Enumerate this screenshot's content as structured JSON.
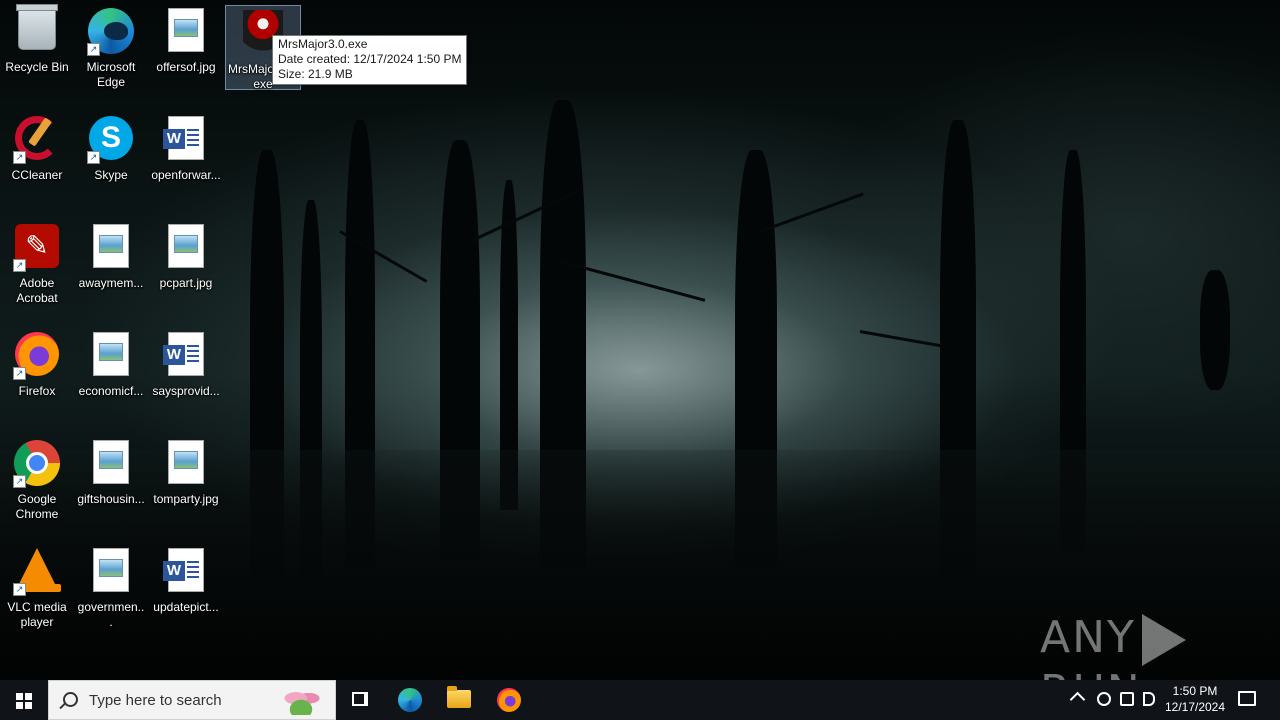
{
  "desktop": {
    "icons": [
      {
        "label": "Recycle Bin",
        "icon": "recycle-bin-icon"
      },
      {
        "label": "Microsoft Edge",
        "icon": "edge-icon"
      },
      {
        "label": "offersof.jpg",
        "icon": "image-file-icon"
      },
      {
        "label": "MrsMajor3.0.exe",
        "icon": "mrsmajor-exe-icon"
      },
      {
        "label": "CCleaner",
        "icon": "ccleaner-icon"
      },
      {
        "label": "Skype",
        "icon": "skype-icon"
      },
      {
        "label": "openforwar...",
        "icon": "word-doc-icon"
      },
      {
        "label": "Adobe Acrobat",
        "icon": "acrobat-icon"
      },
      {
        "label": "awaymem...",
        "icon": "image-file-icon"
      },
      {
        "label": "pcpart.jpg",
        "icon": "image-file-icon"
      },
      {
        "label": "Firefox",
        "icon": "firefox-icon"
      },
      {
        "label": "economicf...",
        "icon": "image-file-icon"
      },
      {
        "label": "saysprovid...",
        "icon": "word-doc-icon"
      },
      {
        "label": "Google Chrome",
        "icon": "chrome-icon"
      },
      {
        "label": "giftshousin...",
        "icon": "image-file-icon"
      },
      {
        "label": "tomparty.jpg",
        "icon": "image-file-icon"
      },
      {
        "label": "VLC media player",
        "icon": "vlc-icon"
      },
      {
        "label": "governmen...",
        "icon": "image-file-icon"
      },
      {
        "label": "updatepict...",
        "icon": "word-doc-icon"
      }
    ],
    "selected_icon_label": "MrsMajor3.0.exe",
    "tooltip": {
      "name": "MrsMajor3.0.exe",
      "date_created": "Date created: 12/17/2024 1:50 PM",
      "size": "Size: 21.9 MB"
    },
    "watermark": {
      "left": "ANY",
      "right": "RUN"
    }
  },
  "taskbar": {
    "search_placeholder": "Type here to search",
    "pinned": [
      "task-view",
      "microsoft-edge",
      "file-explorer",
      "firefox"
    ],
    "clock": {
      "time": "1:50 PM",
      "date": "12/17/2024"
    }
  },
  "colors": {
    "taskbar_bg": "#101418",
    "search_bg": "#f3f3f3",
    "selection": "#7896b4"
  }
}
